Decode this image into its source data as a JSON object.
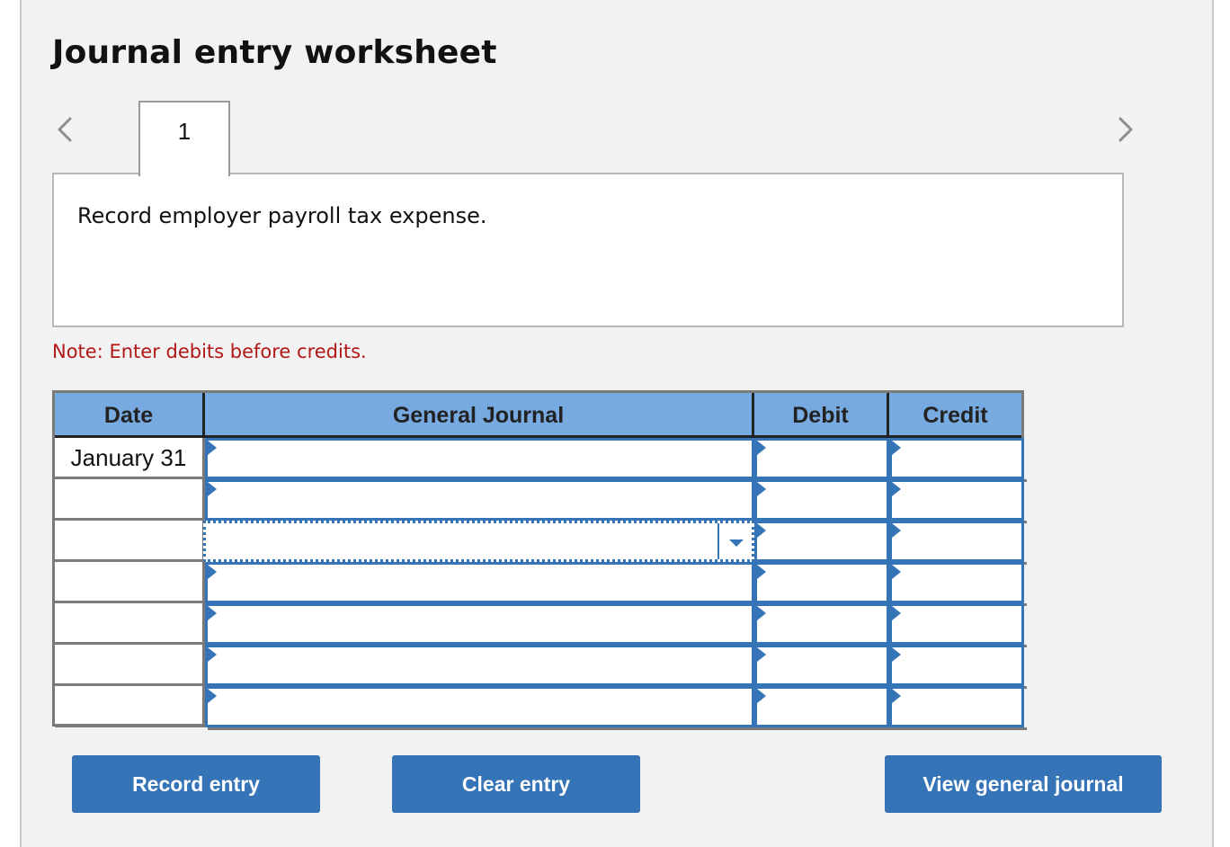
{
  "worksheet": {
    "title": "Journal entry worksheet",
    "nav": {
      "prev_icon": "chevron-left-icon",
      "next_icon": "chevron-right-icon"
    },
    "tabs": [
      {
        "label": "1",
        "active": true
      }
    ],
    "prompt": "Record employer payroll tax expense.",
    "note": "Note: Enter debits before credits."
  },
  "journal": {
    "columns": {
      "date": "Date",
      "general_journal": "General Journal",
      "debit": "Debit",
      "credit": "Credit"
    },
    "rows": [
      {
        "date": "January 31",
        "account": "",
        "debit": "",
        "credit": ""
      },
      {
        "date": "",
        "account": "",
        "debit": "",
        "credit": ""
      },
      {
        "date": "",
        "account": "",
        "debit": "",
        "credit": "",
        "focused": true
      },
      {
        "date": "",
        "account": "",
        "debit": "",
        "credit": ""
      },
      {
        "date": "",
        "account": "",
        "debit": "",
        "credit": ""
      },
      {
        "date": "",
        "account": "",
        "debit": "",
        "credit": ""
      },
      {
        "date": "",
        "account": "",
        "debit": "",
        "credit": ""
      }
    ]
  },
  "buttons": {
    "record": "Record entry",
    "clear": "Clear entry",
    "view": "View general journal"
  },
  "colors": {
    "accent": "#3674b8",
    "header_bg": "#77aae0",
    "note": "#b21818",
    "panel_bg": "#f2f2f2"
  }
}
